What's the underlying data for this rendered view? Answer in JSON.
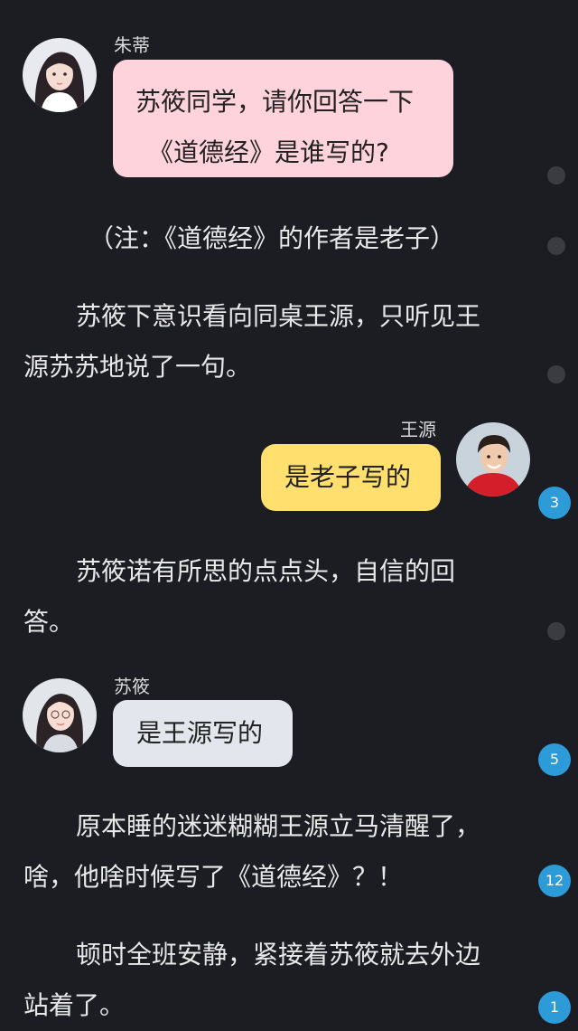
{
  "messages": {
    "zhudi": {
      "name": "朱蒂",
      "lines": [
        "苏筱同学，请你回答一下",
        "《道德经》是谁写的?"
      ],
      "bubble_color": "#ffd3dc"
    },
    "wangyuan": {
      "name": "王源",
      "text": "是老子写的",
      "bubble_color": "#ffdf6e"
    },
    "suxiao": {
      "name": "苏筱",
      "text": "是王源写的",
      "bubble_color": "#e3e7ed"
    }
  },
  "narration": {
    "note": "（注：《道德经》的作者是老子）",
    "p1": [
      "苏筱下意识看向同桌王源，只听见王",
      "源苏苏地说了一句。"
    ],
    "p2": [
      "苏筱诺有所思的点点头，自信的回",
      "答。"
    ],
    "p3": [
      "原本睡的迷迷糊糊王源立马清醒了，",
      "啥，他啥时候写了《道德经》？！"
    ],
    "p4": [
      "顿时全班安静，紧接着苏筱就去外边",
      "站着了。"
    ]
  },
  "comment_badges": {
    "b1": "3",
    "b2": "5",
    "b3": "12",
    "b4": "1"
  },
  "colors": {
    "background": "#1c1d23",
    "badge": "#2d9bd8",
    "dot": "#3b3c42"
  }
}
